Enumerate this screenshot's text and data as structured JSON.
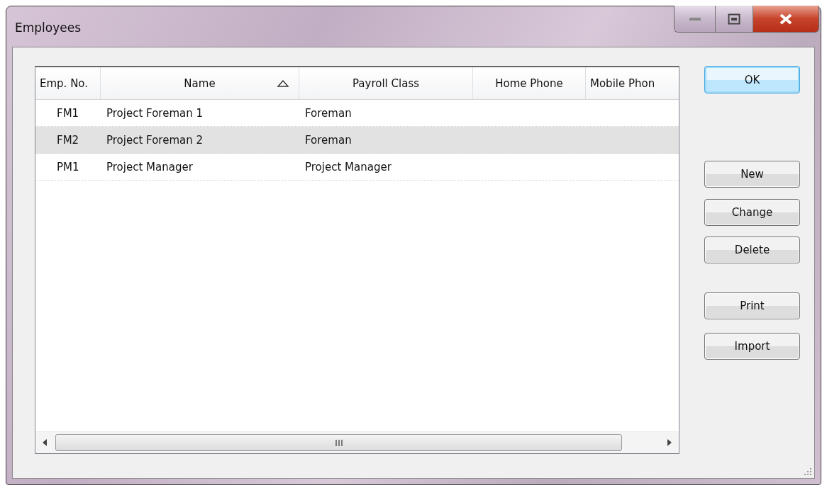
{
  "window": {
    "title": "Employees"
  },
  "table": {
    "columns": [
      {
        "label": "Emp. No.",
        "sorted": false
      },
      {
        "label": "Name",
        "sorted": true
      },
      {
        "label": "Payroll Class",
        "sorted": false
      },
      {
        "label": "Home Phone",
        "sorted": false
      },
      {
        "label": "Mobile Phon",
        "sorted": false
      }
    ],
    "rows": [
      {
        "selected": false,
        "cells": [
          "FM1",
          "Project Foreman 1",
          "Foreman"
        ]
      },
      {
        "selected": true,
        "cells": [
          "FM2",
          "Project Foreman 2",
          "Foreman"
        ]
      },
      {
        "selected": false,
        "cells": [
          "PM1",
          "Project Manager",
          "Project Manager"
        ]
      }
    ]
  },
  "buttons": [
    {
      "label": "OK",
      "kind": "default"
    },
    {
      "label": "New",
      "kind": "normal"
    },
    {
      "label": "Change",
      "kind": "normal"
    },
    {
      "label": "Delete",
      "kind": "normal"
    },
    {
      "label": "Print",
      "kind": "normal"
    },
    {
      "label": "Import",
      "kind": "normal"
    }
  ]
}
